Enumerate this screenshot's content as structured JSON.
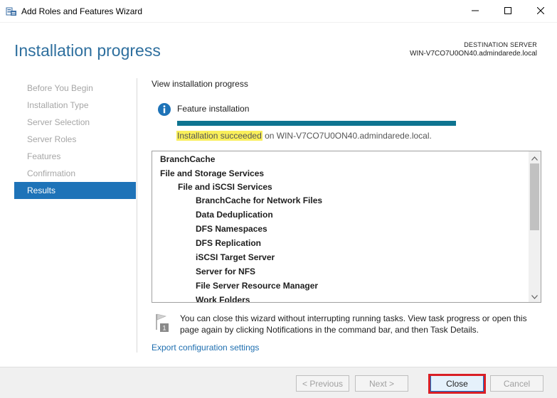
{
  "window": {
    "title": "Add Roles and Features Wizard",
    "controls": [
      "minimize-icon",
      "maximize-icon",
      "close-icon"
    ]
  },
  "header": {
    "page_title": "Installation progress",
    "destination_label": "DESTINATION SERVER",
    "destination_server": "WIN-V7CO7U0ON40.admindarede.local"
  },
  "nav": {
    "items": [
      {
        "label": "Before You Begin",
        "state": "disabled"
      },
      {
        "label": "Installation Type",
        "state": "disabled"
      },
      {
        "label": "Server Selection",
        "state": "disabled"
      },
      {
        "label": "Server Roles",
        "state": "disabled"
      },
      {
        "label": "Features",
        "state": "disabled"
      },
      {
        "label": "Confirmation",
        "state": "disabled"
      },
      {
        "label": "Results",
        "state": "active"
      }
    ]
  },
  "main": {
    "section_title": "View installation progress",
    "feature_label": "Feature installation",
    "progress": 1.0,
    "result_status": "Installation succeeded",
    "result_rest": " on WIN-V7CO7U0ON40.admindarede.local.",
    "list_items": [
      {
        "label": "BranchCache",
        "level": 0
      },
      {
        "label": "File and Storage Services",
        "level": 0
      },
      {
        "label": "File and iSCSI Services",
        "level": 1
      },
      {
        "label": "BranchCache for Network Files",
        "level": 2
      },
      {
        "label": "Data Deduplication",
        "level": 2
      },
      {
        "label": "DFS Namespaces",
        "level": 2
      },
      {
        "label": "DFS Replication",
        "level": 2
      },
      {
        "label": "iSCSI Target Server",
        "level": 2
      },
      {
        "label": "Server for NFS",
        "level": 2
      },
      {
        "label": "File Server Resource Manager",
        "level": 2
      },
      {
        "label": "Work Folders",
        "level": 2
      }
    ],
    "note_text": "You can close this wizard without interrupting running tasks. View task progress or open this page again by clicking Notifications in the command bar, and then Task Details.",
    "note_badge": "1",
    "export_link": "Export configuration settings"
  },
  "footer": {
    "previous_label": "< Previous",
    "next_label": "Next >",
    "close_label": "Close",
    "cancel_label": "Cancel"
  },
  "colors": {
    "accent": "#1e73b8",
    "title_blue": "#2e6f9e",
    "progress": "#0e7490",
    "highlight": "#f9ef5a",
    "annotation_red": "#d91f26"
  }
}
